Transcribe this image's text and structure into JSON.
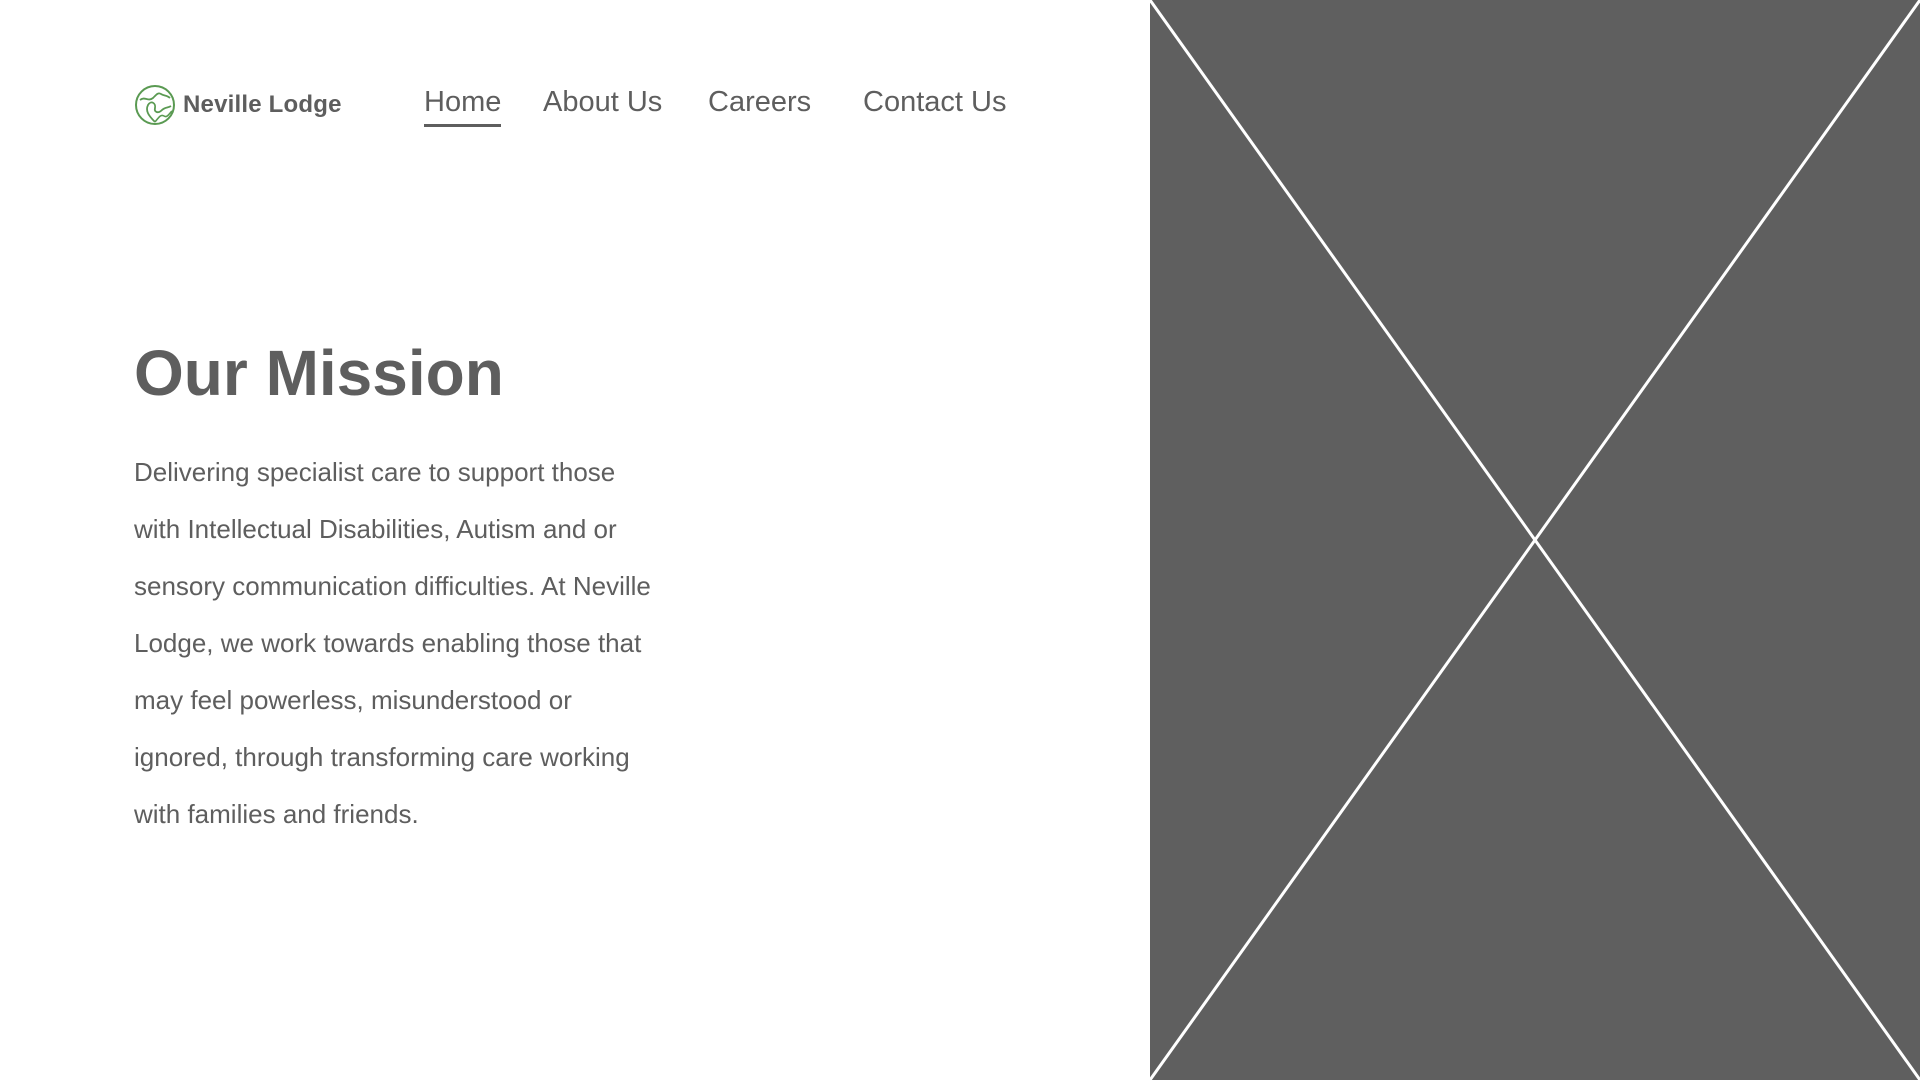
{
  "brand": {
    "name": "Neville Lodge",
    "logo_icon": "leaf-globe-icon",
    "accent_color": "#5a9a52"
  },
  "nav": {
    "items": [
      {
        "label": "Home",
        "active": true
      },
      {
        "label": "About Us",
        "active": false
      },
      {
        "label": "Careers",
        "active": false
      },
      {
        "label": "Contact Us",
        "active": false
      }
    ]
  },
  "hero": {
    "title": "Our Mission",
    "body_lines": [
      "Delivering specialist care to support those",
      "with Intellectual Disabilities, Autism and or",
      "sensory communication difficulties. At Neville",
      "Lodge, we work towards enabling those that",
      "may feel powerless, misunderstood or",
      "ignored, through transforming care working",
      "with families and friends."
    ],
    "image_placeholder_color": "#5f5f5f"
  },
  "colors": {
    "text": "#5e5e5e",
    "background": "#ffffff"
  }
}
